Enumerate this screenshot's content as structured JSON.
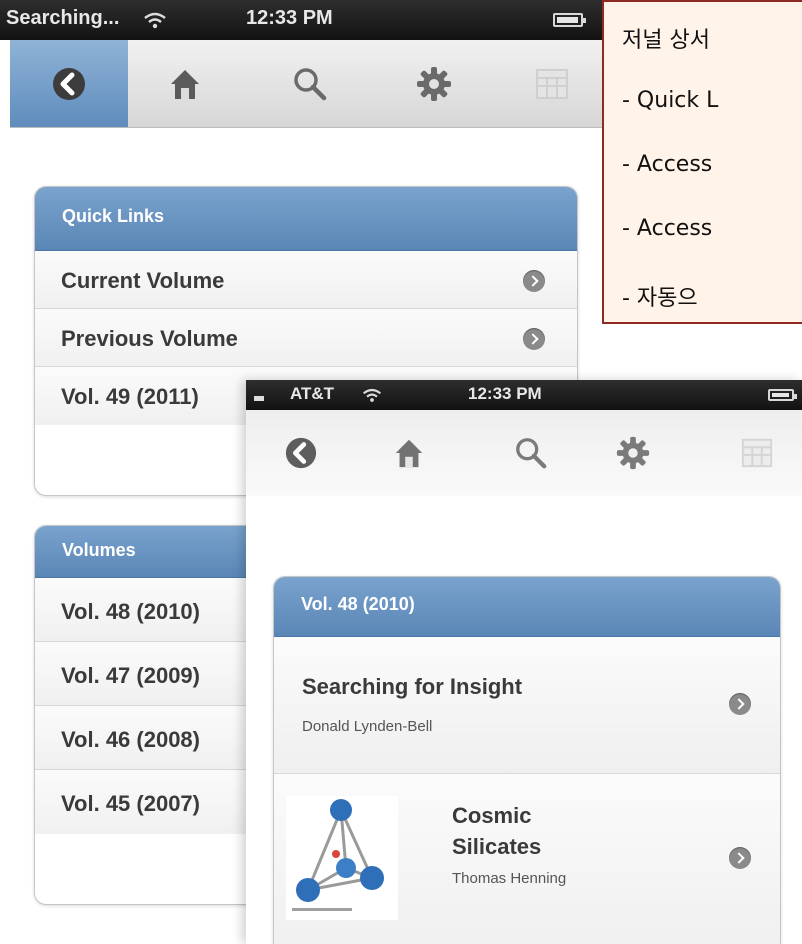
{
  "back_phone": {
    "status": {
      "carrier": "Searching...",
      "time": "12:33 PM"
    },
    "toolbar": {
      "buttons": [
        "back-icon",
        "home-icon",
        "search-icon",
        "gear-icon",
        "table-icon"
      ]
    },
    "quick_links": {
      "header": "Quick Links",
      "items": [
        "Current Volume",
        "Previous Volume",
        "Vol. 49 (2011)"
      ]
    },
    "volumes": {
      "header": "Volumes",
      "items": [
        "Vol. 48 (2010)",
        "Vol. 47 (2009)",
        "Vol. 46 (2008)",
        "Vol. 45 (2007)"
      ]
    }
  },
  "front_phone": {
    "status": {
      "carrier": "AT&T",
      "time": "12:33 PM"
    },
    "toolbar": {
      "buttons": [
        "back-icon",
        "home-icon",
        "search-icon",
        "gear-icon",
        "table-icon"
      ]
    },
    "panel": {
      "header": "Vol. 48 (2010)",
      "articles": [
        {
          "title": "Searching for Insight",
          "author": "Donald Lynden-Bell"
        },
        {
          "title_line1": "Cosmic",
          "title_line2": "Silicates",
          "author": "Thomas Henning"
        }
      ]
    }
  },
  "annotation": {
    "lines": [
      "저널 상서",
      "- Quick L",
      "- Access",
      "- Access",
      "- 자동으"
    ]
  },
  "colors": {
    "header_blue": "#6a95c2",
    "annotation_border": "#8f2a22",
    "annotation_bg": "#fff3ea"
  }
}
